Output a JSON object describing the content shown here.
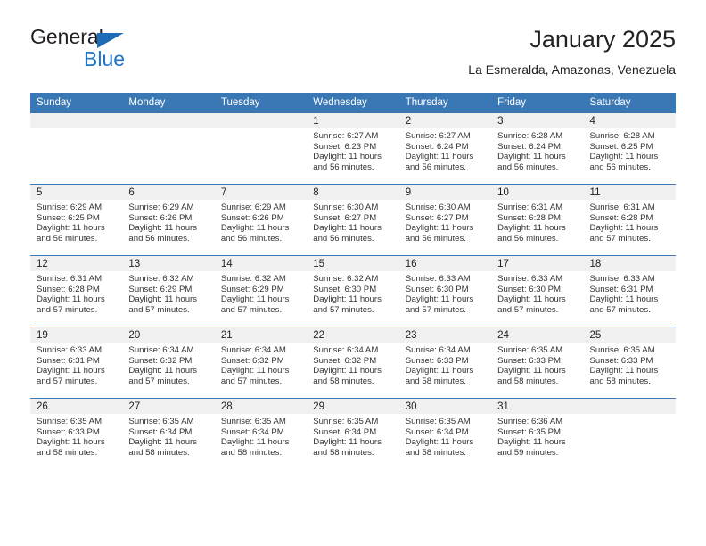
{
  "logo": {
    "word_one": "General",
    "word_two": "Blue",
    "triangle_color": "#1e6bb8",
    "blue_color": "#1e76c4"
  },
  "header": {
    "title": "January 2025",
    "subtitle": "La Esmeralda, Amazonas, Venezuela",
    "accent_color": "#3a78b5"
  },
  "calendar": {
    "weekday_headers": [
      "Sunday",
      "Monday",
      "Tuesday",
      "Wednesday",
      "Thursday",
      "Friday",
      "Saturday"
    ],
    "labels": {
      "sunrise": "Sunrise:",
      "sunset": "Sunset:",
      "daylight": "Daylight:"
    },
    "weeks": [
      [
        {
          "empty": true
        },
        {
          "empty": true
        },
        {
          "empty": true
        },
        {
          "day": "1",
          "sunrise": "Sunrise: 6:27 AM",
          "sunset": "Sunset: 6:23 PM",
          "daylight_line1": "Daylight: 11 hours",
          "daylight_line2": "and 56 minutes."
        },
        {
          "day": "2",
          "sunrise": "Sunrise: 6:27 AM",
          "sunset": "Sunset: 6:24 PM",
          "daylight_line1": "Daylight: 11 hours",
          "daylight_line2": "and 56 minutes."
        },
        {
          "day": "3",
          "sunrise": "Sunrise: 6:28 AM",
          "sunset": "Sunset: 6:24 PM",
          "daylight_line1": "Daylight: 11 hours",
          "daylight_line2": "and 56 minutes."
        },
        {
          "day": "4",
          "sunrise": "Sunrise: 6:28 AM",
          "sunset": "Sunset: 6:25 PM",
          "daylight_line1": "Daylight: 11 hours",
          "daylight_line2": "and 56 minutes."
        }
      ],
      [
        {
          "day": "5",
          "sunrise": "Sunrise: 6:29 AM",
          "sunset": "Sunset: 6:25 PM",
          "daylight_line1": "Daylight: 11 hours",
          "daylight_line2": "and 56 minutes."
        },
        {
          "day": "6",
          "sunrise": "Sunrise: 6:29 AM",
          "sunset": "Sunset: 6:26 PM",
          "daylight_line1": "Daylight: 11 hours",
          "daylight_line2": "and 56 minutes."
        },
        {
          "day": "7",
          "sunrise": "Sunrise: 6:29 AM",
          "sunset": "Sunset: 6:26 PM",
          "daylight_line1": "Daylight: 11 hours",
          "daylight_line2": "and 56 minutes."
        },
        {
          "day": "8",
          "sunrise": "Sunrise: 6:30 AM",
          "sunset": "Sunset: 6:27 PM",
          "daylight_line1": "Daylight: 11 hours",
          "daylight_line2": "and 56 minutes."
        },
        {
          "day": "9",
          "sunrise": "Sunrise: 6:30 AM",
          "sunset": "Sunset: 6:27 PM",
          "daylight_line1": "Daylight: 11 hours",
          "daylight_line2": "and 56 minutes."
        },
        {
          "day": "10",
          "sunrise": "Sunrise: 6:31 AM",
          "sunset": "Sunset: 6:28 PM",
          "daylight_line1": "Daylight: 11 hours",
          "daylight_line2": "and 56 minutes."
        },
        {
          "day": "11",
          "sunrise": "Sunrise: 6:31 AM",
          "sunset": "Sunset: 6:28 PM",
          "daylight_line1": "Daylight: 11 hours",
          "daylight_line2": "and 57 minutes."
        }
      ],
      [
        {
          "day": "12",
          "sunrise": "Sunrise: 6:31 AM",
          "sunset": "Sunset: 6:28 PM",
          "daylight_line1": "Daylight: 11 hours",
          "daylight_line2": "and 57 minutes."
        },
        {
          "day": "13",
          "sunrise": "Sunrise: 6:32 AM",
          "sunset": "Sunset: 6:29 PM",
          "daylight_line1": "Daylight: 11 hours",
          "daylight_line2": "and 57 minutes."
        },
        {
          "day": "14",
          "sunrise": "Sunrise: 6:32 AM",
          "sunset": "Sunset: 6:29 PM",
          "daylight_line1": "Daylight: 11 hours",
          "daylight_line2": "and 57 minutes."
        },
        {
          "day": "15",
          "sunrise": "Sunrise: 6:32 AM",
          "sunset": "Sunset: 6:30 PM",
          "daylight_line1": "Daylight: 11 hours",
          "daylight_line2": "and 57 minutes."
        },
        {
          "day": "16",
          "sunrise": "Sunrise: 6:33 AM",
          "sunset": "Sunset: 6:30 PM",
          "daylight_line1": "Daylight: 11 hours",
          "daylight_line2": "and 57 minutes."
        },
        {
          "day": "17",
          "sunrise": "Sunrise: 6:33 AM",
          "sunset": "Sunset: 6:30 PM",
          "daylight_line1": "Daylight: 11 hours",
          "daylight_line2": "and 57 minutes."
        },
        {
          "day": "18",
          "sunrise": "Sunrise: 6:33 AM",
          "sunset": "Sunset: 6:31 PM",
          "daylight_line1": "Daylight: 11 hours",
          "daylight_line2": "and 57 minutes."
        }
      ],
      [
        {
          "day": "19",
          "sunrise": "Sunrise: 6:33 AM",
          "sunset": "Sunset: 6:31 PM",
          "daylight_line1": "Daylight: 11 hours",
          "daylight_line2": "and 57 minutes."
        },
        {
          "day": "20",
          "sunrise": "Sunrise: 6:34 AM",
          "sunset": "Sunset: 6:32 PM",
          "daylight_line1": "Daylight: 11 hours",
          "daylight_line2": "and 57 minutes."
        },
        {
          "day": "21",
          "sunrise": "Sunrise: 6:34 AM",
          "sunset": "Sunset: 6:32 PM",
          "daylight_line1": "Daylight: 11 hours",
          "daylight_line2": "and 57 minutes."
        },
        {
          "day": "22",
          "sunrise": "Sunrise: 6:34 AM",
          "sunset": "Sunset: 6:32 PM",
          "daylight_line1": "Daylight: 11 hours",
          "daylight_line2": "and 58 minutes."
        },
        {
          "day": "23",
          "sunrise": "Sunrise: 6:34 AM",
          "sunset": "Sunset: 6:33 PM",
          "daylight_line1": "Daylight: 11 hours",
          "daylight_line2": "and 58 minutes."
        },
        {
          "day": "24",
          "sunrise": "Sunrise: 6:35 AM",
          "sunset": "Sunset: 6:33 PM",
          "daylight_line1": "Daylight: 11 hours",
          "daylight_line2": "and 58 minutes."
        },
        {
          "day": "25",
          "sunrise": "Sunrise: 6:35 AM",
          "sunset": "Sunset: 6:33 PM",
          "daylight_line1": "Daylight: 11 hours",
          "daylight_line2": "and 58 minutes."
        }
      ],
      [
        {
          "day": "26",
          "sunrise": "Sunrise: 6:35 AM",
          "sunset": "Sunset: 6:33 PM",
          "daylight_line1": "Daylight: 11 hours",
          "daylight_line2": "and 58 minutes."
        },
        {
          "day": "27",
          "sunrise": "Sunrise: 6:35 AM",
          "sunset": "Sunset: 6:34 PM",
          "daylight_line1": "Daylight: 11 hours",
          "daylight_line2": "and 58 minutes."
        },
        {
          "day": "28",
          "sunrise": "Sunrise: 6:35 AM",
          "sunset": "Sunset: 6:34 PM",
          "daylight_line1": "Daylight: 11 hours",
          "daylight_line2": "and 58 minutes."
        },
        {
          "day": "29",
          "sunrise": "Sunrise: 6:35 AM",
          "sunset": "Sunset: 6:34 PM",
          "daylight_line1": "Daylight: 11 hours",
          "daylight_line2": "and 58 minutes."
        },
        {
          "day": "30",
          "sunrise": "Sunrise: 6:35 AM",
          "sunset": "Sunset: 6:34 PM",
          "daylight_line1": "Daylight: 11 hours",
          "daylight_line2": "and 58 minutes."
        },
        {
          "day": "31",
          "sunrise": "Sunrise: 6:36 AM",
          "sunset": "Sunset: 6:35 PM",
          "daylight_line1": "Daylight: 11 hours",
          "daylight_line2": "and 59 minutes."
        },
        {
          "empty": true
        }
      ]
    ]
  }
}
